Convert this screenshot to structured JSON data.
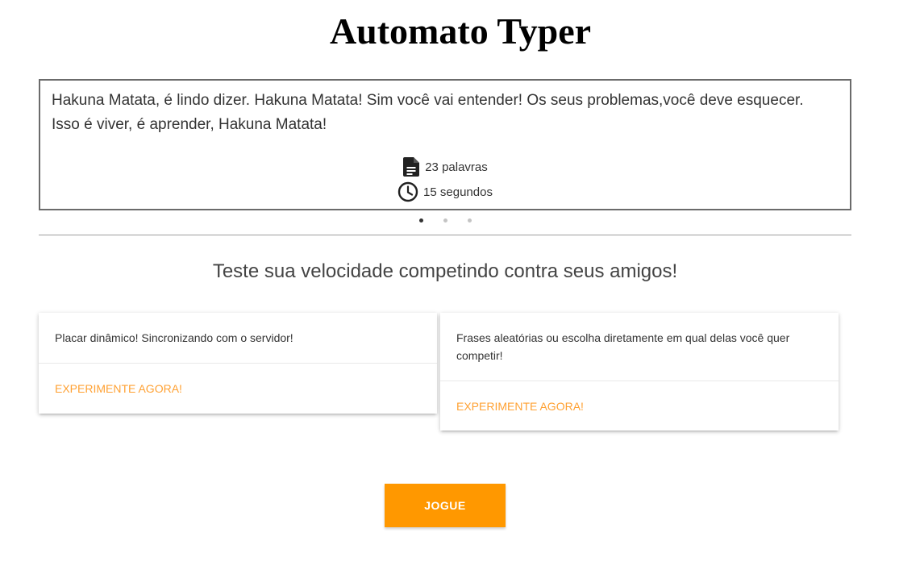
{
  "header": {
    "title": "Automato Typer"
  },
  "carousel": {
    "slide": {
      "text": "Hakuna Matata, é lindo dizer. Hakuna Matata! Sim você vai entender! Os seus problemas,você deve esquecer. Isso é viver, é aprender, Hakuna Matata!",
      "words_icon": "document-icon",
      "words_label": "23 palavras",
      "time_icon": "clock-icon",
      "time_label": "15 segundos"
    },
    "dots": {
      "count": 3,
      "active_index": 1
    }
  },
  "main": {
    "subtitle": "Teste sua velocidade competindo contra seus amigos!",
    "cards": [
      {
        "text": "Placar dinâmico! Sincronizando com o servidor!",
        "action_label": "EXPERIMENTE AGORA!"
      },
      {
        "text": "Frases aleatórias ou escolha diretamente em qual delas você quer competir!",
        "action_label": "EXPERIMENTE AGORA!"
      }
    ],
    "play_button_label": "JOGUE"
  },
  "colors": {
    "accent": "#ff9800",
    "link": "#ffa133",
    "slide_border": "#6b6b6b",
    "divider": "#9e9e9e"
  }
}
